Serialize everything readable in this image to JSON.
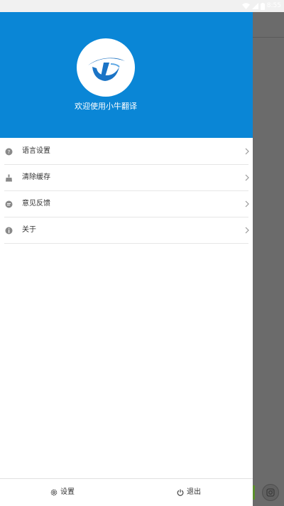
{
  "status_bar": {
    "time": "8:55",
    "icons": [
      "wifi-icon",
      "signal-icon",
      "battery-icon"
    ]
  },
  "drawer": {
    "header": {
      "logo_icon": "xiaoniu-logo",
      "welcome_text": "欢迎使用小牛翻译",
      "background_color": "#0a86d6"
    },
    "menu": {
      "items": [
        {
          "label": "语言设置",
          "icon": "language-icon"
        },
        {
          "label": "清除缓存",
          "icon": "broom-icon"
        },
        {
          "label": "意见反馈",
          "icon": "feedback-icon"
        },
        {
          "label": "关于",
          "icon": "info-icon"
        }
      ]
    },
    "footer": {
      "settings_label": "设置",
      "settings_icon": "gear-icon",
      "logout_label": "退出",
      "logout_icon": "power-icon"
    }
  },
  "background_app": {
    "camera_icon": "camera-icon"
  }
}
